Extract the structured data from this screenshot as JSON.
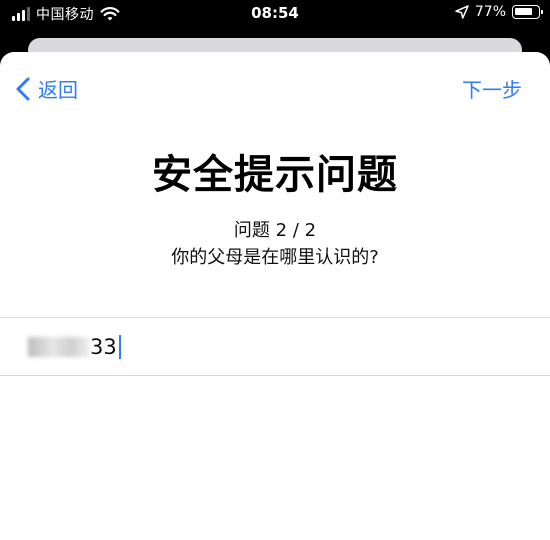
{
  "status_bar": {
    "carrier": "中国移动",
    "time": "08:54",
    "battery": "77%",
    "battery_level": 0.77,
    "icons": [
      "signal-icon",
      "wifi-icon",
      "location-arrow-icon",
      "battery-icon"
    ]
  },
  "nav": {
    "back_label": "返回",
    "next_label": "下一步"
  },
  "page": {
    "title": "安全提示问题",
    "progress": "问题 2 / 2",
    "question": "你的父母是在哪里认识的?"
  },
  "answer": {
    "visible_value": "33",
    "masked": true
  },
  "colors": {
    "accent": "#2f7cf6",
    "background": "#ffffff",
    "status_bar": "#000000"
  }
}
